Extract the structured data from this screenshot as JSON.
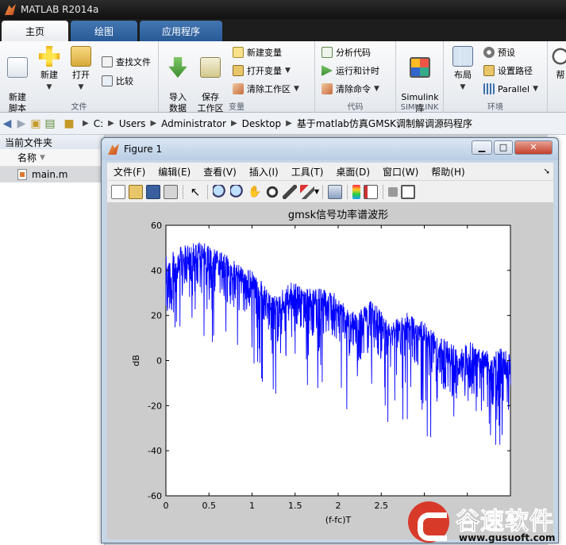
{
  "app": {
    "title": "MATLAB R2014a"
  },
  "tabs": [
    {
      "label": "主页",
      "active": true
    },
    {
      "label": "绘图",
      "active": false
    },
    {
      "label": "应用程序",
      "active": false
    }
  ],
  "ribbon": {
    "groups": {
      "file": "文件",
      "variable": "变量",
      "code": "代码",
      "simulink": "SIMULINK",
      "environment": "环境"
    },
    "new_script": "新建\n脚本",
    "new": "新建",
    "open": "打开",
    "find_files": "查找文件",
    "compare": "比较",
    "import_data": "导入\n数据",
    "save_workspace": "保存\n工作区",
    "new_variable": "新建变量",
    "open_variable": "打开变量",
    "clear_workspace": "清除工作区",
    "analyze_code": "分析代码",
    "run_and_time": "运行和计时",
    "clear_commands": "清除命令",
    "simulink_lib": "Simulink\n库",
    "layout": "布局",
    "preferences": "预设",
    "set_path": "设置路径",
    "parallel": "Parallel",
    "help": "帮"
  },
  "address": {
    "crumbs": [
      "C:",
      "Users",
      "Administrator",
      "Desktop",
      "基于matlab仿真GMSK调制解调源码程序"
    ]
  },
  "file_panel": {
    "title": "当前文件夹",
    "column": "名称",
    "files": [
      "main.m"
    ]
  },
  "figure": {
    "title": "Figure 1",
    "menu": [
      "文件(F)",
      "编辑(E)",
      "查看(V)",
      "插入(I)",
      "工具(T)",
      "桌面(D)",
      "窗口(W)",
      "帮助(H)"
    ]
  },
  "colors": {
    "series": "#0000ff",
    "accent": "#285a96"
  },
  "chart_data": {
    "type": "line",
    "title": "gmsk信号功率谱波形",
    "xlabel": "(f-fc)T",
    "ylabel": "dB",
    "xlim": [
      0,
      4
    ],
    "ylim": [
      -60,
      60
    ],
    "xticks": [
      0,
      0.5,
      1,
      1.5,
      2,
      2.5,
      3,
      3.5,
      4
    ],
    "xtick_labels": [
      "0",
      "0.5",
      "1",
      "1.5",
      "2",
      "2.5",
      "",
      "",
      ""
    ],
    "yticks": [
      -60,
      -40,
      -20,
      0,
      20,
      40,
      60
    ],
    "grid": false,
    "series": [
      {
        "color": "#0000ff",
        "envelope": {
          "x": [
            0,
            0.1,
            0.2,
            0.3,
            0.4,
            0.5,
            0.6,
            0.7,
            0.8,
            0.9,
            1.0,
            1.1,
            1.2,
            1.3,
            1.4,
            1.5,
            1.6,
            1.7,
            1.8,
            1.9,
            2.0,
            2.1,
            2.2,
            2.3,
            2.4,
            2.5,
            2.6,
            2.7,
            2.8,
            2.9,
            3.0,
            3.1,
            3.2,
            3.3,
            3.4,
            3.5,
            3.6,
            3.7,
            3.8,
            3.9,
            4.0
          ],
          "upper": [
            46,
            49,
            51,
            52,
            53,
            51,
            49,
            47,
            44,
            42,
            40,
            36,
            30,
            29,
            34,
            35,
            33,
            32,
            32,
            31,
            29,
            24,
            21,
            24,
            27,
            22,
            17,
            19,
            22,
            19,
            17,
            13,
            10,
            9,
            4,
            11,
            7,
            5,
            6,
            7,
            3
          ],
          "lower": [
            15,
            22,
            26,
            28,
            30,
            31,
            28,
            26,
            23,
            21,
            19,
            15,
            9,
            7,
            13,
            15,
            13,
            11,
            11,
            11,
            9,
            3,
            -1,
            1,
            4,
            1,
            -4,
            -2,
            1,
            -2,
            -4,
            -9,
            -13,
            -15,
            -20,
            -14,
            -18,
            -21,
            -21,
            -20,
            -24
          ],
          "min": [
            10,
            5,
            14,
            13,
            8,
            6,
            3,
            5,
            1,
            -2,
            -6,
            -10,
            -15,
            -16,
            -11,
            -10,
            -12,
            -13,
            -14,
            -14,
            -20,
            -22,
            -26,
            -26,
            -24,
            -25,
            -31,
            -34,
            -30,
            -32,
            -32,
            -37,
            -40,
            -44,
            -48,
            -40,
            -41,
            -47,
            -44,
            -43,
            -43
          ]
        }
      }
    ]
  }
}
